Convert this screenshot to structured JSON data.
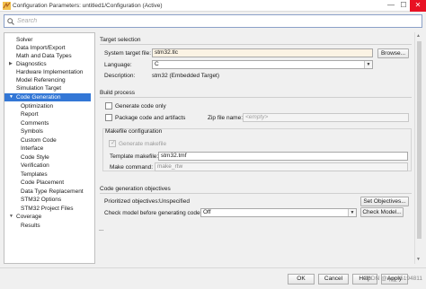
{
  "window": {
    "title": "Configuration Parameters: untitled1/Configuration (Active)",
    "min_glyph": "—",
    "max_glyph": "☐",
    "close_glyph": "✕"
  },
  "search": {
    "placeholder": "Search"
  },
  "tree": {
    "items": [
      {
        "label": "Solver"
      },
      {
        "label": "Data Import/Export"
      },
      {
        "label": "Math and Data Types"
      },
      {
        "label": "Diagnostics",
        "expander": "▶"
      },
      {
        "label": "Hardware Implementation"
      },
      {
        "label": "Model Referencing"
      },
      {
        "label": "Simulation Target"
      },
      {
        "label": "Code Generation",
        "expander": "▼",
        "selected": true
      },
      {
        "label": "Optimization"
      },
      {
        "label": "Report"
      },
      {
        "label": "Comments"
      },
      {
        "label": "Symbols"
      },
      {
        "label": "Custom Code"
      },
      {
        "label": "Interface"
      },
      {
        "label": "Code Style"
      },
      {
        "label": "Verification"
      },
      {
        "label": "Templates"
      },
      {
        "label": "Code Placement"
      },
      {
        "label": "Data Type Replacement"
      },
      {
        "label": "STM32 Options"
      },
      {
        "label": "STM32 Project Files"
      },
      {
        "label": "Coverage",
        "expander": "▼"
      },
      {
        "label": "Results"
      }
    ]
  },
  "target_selection": {
    "heading": "Target selection",
    "system_target_file_label": "System target file:",
    "system_target_file_value": "stm32.tlc",
    "browse_label": "Browse...",
    "language_label": "Language:",
    "language_value": "C",
    "description_label": "Description:",
    "description_value": "stm32 (Embedded Target)"
  },
  "build_process": {
    "heading": "Build process",
    "generate_code_only_label": "Generate code only",
    "package_label": "Package code and artifacts",
    "zip_label": "Zip file name:",
    "zip_placeholder": "<empty>",
    "makefile_heading": "Makefile configuration",
    "generate_makefile_label": "Generate makefile",
    "template_makefile_label": "Template makefile:",
    "template_makefile_value": "stm32.tmf",
    "make_command_label": "Make command:",
    "make_command_value": "make_rtw"
  },
  "objectives": {
    "heading": "Code generation objectives",
    "prioritized_label": "Prioritized objectives:",
    "prioritized_value": "Unspecified",
    "set_objectives_label": "Set Objectives...",
    "check_model_label": "Check model before generating code:",
    "check_model_value": "Off",
    "check_model_button": "Check Model..."
  },
  "more_indicator": "...",
  "footer": {
    "ok_label": "OK",
    "cancel_label": "Cancel",
    "help_label": "Help",
    "apply_label": "Apply",
    "watermark": "CSDN @qq_45194811"
  },
  "icons": {
    "app": "simulink-icon",
    "search": "search-icon"
  }
}
